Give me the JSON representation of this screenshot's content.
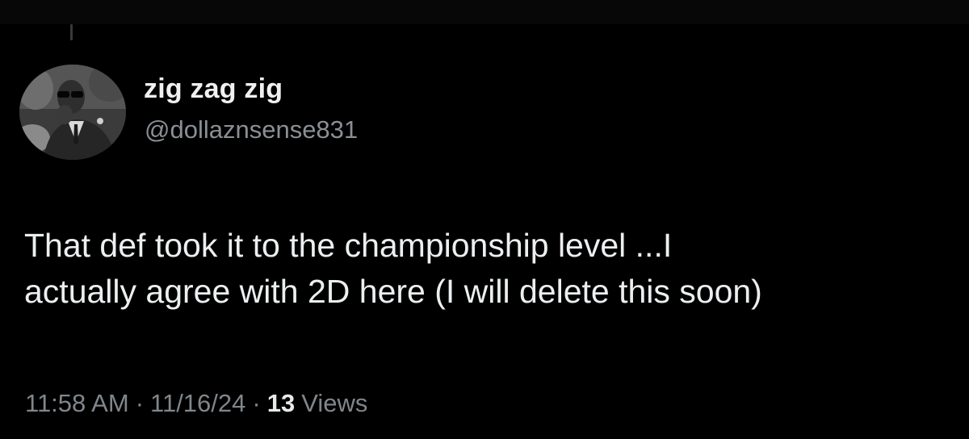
{
  "author": {
    "display_name": "zig zag zig",
    "handle": "@dollaznsense831",
    "avatar_icon": "profile-photo-avatar"
  },
  "tweet": {
    "text_lines": [
      "That def took it to the championship level ...I",
      "actually agree with 2D here (I will delete this soon)"
    ]
  },
  "meta": {
    "time": "11:58 AM",
    "separator": "·",
    "date": "11/16/24",
    "views_count": "13",
    "views_label": "Views"
  },
  "colors": {
    "background": "#000000",
    "text_primary": "#e7e9ea",
    "text_secondary": "#80868b"
  }
}
